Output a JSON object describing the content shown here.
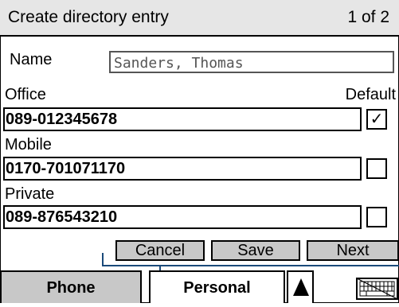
{
  "header": {
    "title": "Create directory entry",
    "page": "1 of 2"
  },
  "name": {
    "label": "Name",
    "value": "Sanders, Thomas"
  },
  "office": {
    "label": "Office",
    "default_label": "Default",
    "number": "089-012345678",
    "checked_mark": "✓"
  },
  "mobile": {
    "label": "Mobile",
    "number": "0170-701071170"
  },
  "private": {
    "label": "Private",
    "number": "089-876543210"
  },
  "actions": {
    "cancel": "Cancel",
    "save": "Save",
    "next": "Next"
  },
  "tabs": {
    "phone": "Phone",
    "personal": "Personal"
  },
  "icons": {
    "scroll": "arrow-up-icon",
    "keyboard": "keyboard-icon"
  },
  "colors": {
    "header_bg": "#e6e6e6",
    "button_bg": "#c8c8c8",
    "connector": "#1a4a7a"
  }
}
